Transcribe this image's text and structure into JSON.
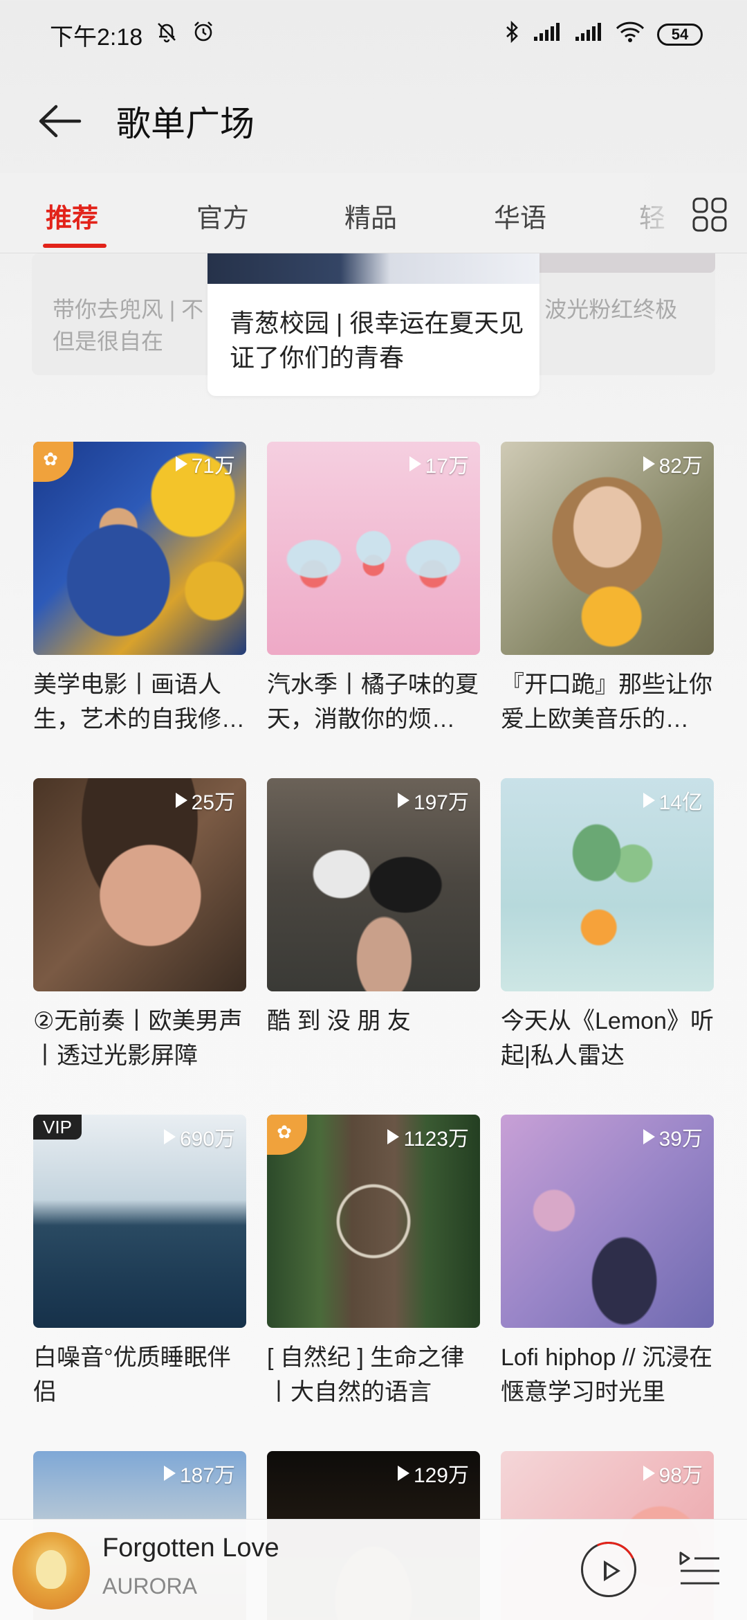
{
  "status_bar": {
    "time": "下午2:18",
    "battery": "54",
    "icons": [
      "bell-muted-icon",
      "alarm-icon",
      "bluetooth-icon",
      "signal-icon",
      "signal-icon",
      "wifi-icon",
      "battery-icon"
    ]
  },
  "header": {
    "title": "歌单广场",
    "back_icon": "back-arrow-icon"
  },
  "tabs": [
    {
      "label": "推荐",
      "active": true
    },
    {
      "label": "官方",
      "active": false
    },
    {
      "label": "精品",
      "active": false
    },
    {
      "label": "华语",
      "active": false
    },
    {
      "label": "轻",
      "active": false
    }
  ],
  "tab_grid_icon": "category-grid-icon",
  "banner": {
    "left_text": "带你去兜风 | 不\n但是很自在",
    "center_text": "青葱校园 | 很幸运在夏天见证了你们的青春",
    "right_text": "| 波光粉红终极"
  },
  "playlists": [
    {
      "title": "美学电影丨画语人生，艺术的自我修…",
      "count": "71万",
      "badge": "corner"
    },
    {
      "title": "汽水季丨橘子味的夏天，消散你的烦…",
      "count": "17万",
      "badge": ""
    },
    {
      "title": "『开口跪』那些让你爱上欧美音乐的…",
      "count": "82万",
      "badge": ""
    },
    {
      "title": "②无前奏丨欧美男声丨透过光影屏障",
      "count": "25万",
      "badge": ""
    },
    {
      "title": "酷 到 没 朋 友",
      "count": "197万",
      "badge": ""
    },
    {
      "title": "今天从《Lemon》听起|私人雷达",
      "count": "14亿",
      "badge": ""
    },
    {
      "title": "白噪音°优质睡眠伴侣",
      "count": "690万",
      "badge": "vip"
    },
    {
      "title": "[ 自然纪 ] 生命之律丨大自然的语言",
      "count": "1123万",
      "badge": "corner"
    },
    {
      "title": "Lofi hiphop // 沉浸在惬意学习时光里",
      "count": "39万",
      "badge": ""
    },
    {
      "title": "",
      "count": "187万",
      "badge": ""
    },
    {
      "title": "",
      "count": "129万",
      "badge": ""
    },
    {
      "title": "",
      "count": "98万",
      "badge": ""
    }
  ],
  "badges": {
    "vip": "VIP"
  },
  "player": {
    "song": "Forgotten Love",
    "artist": "AURORA",
    "play_icon": "play-icon",
    "playlist_icon": "playlist-icon"
  },
  "colors": {
    "accent": "#e2231a",
    "badge_orange": "#f0a23c"
  }
}
